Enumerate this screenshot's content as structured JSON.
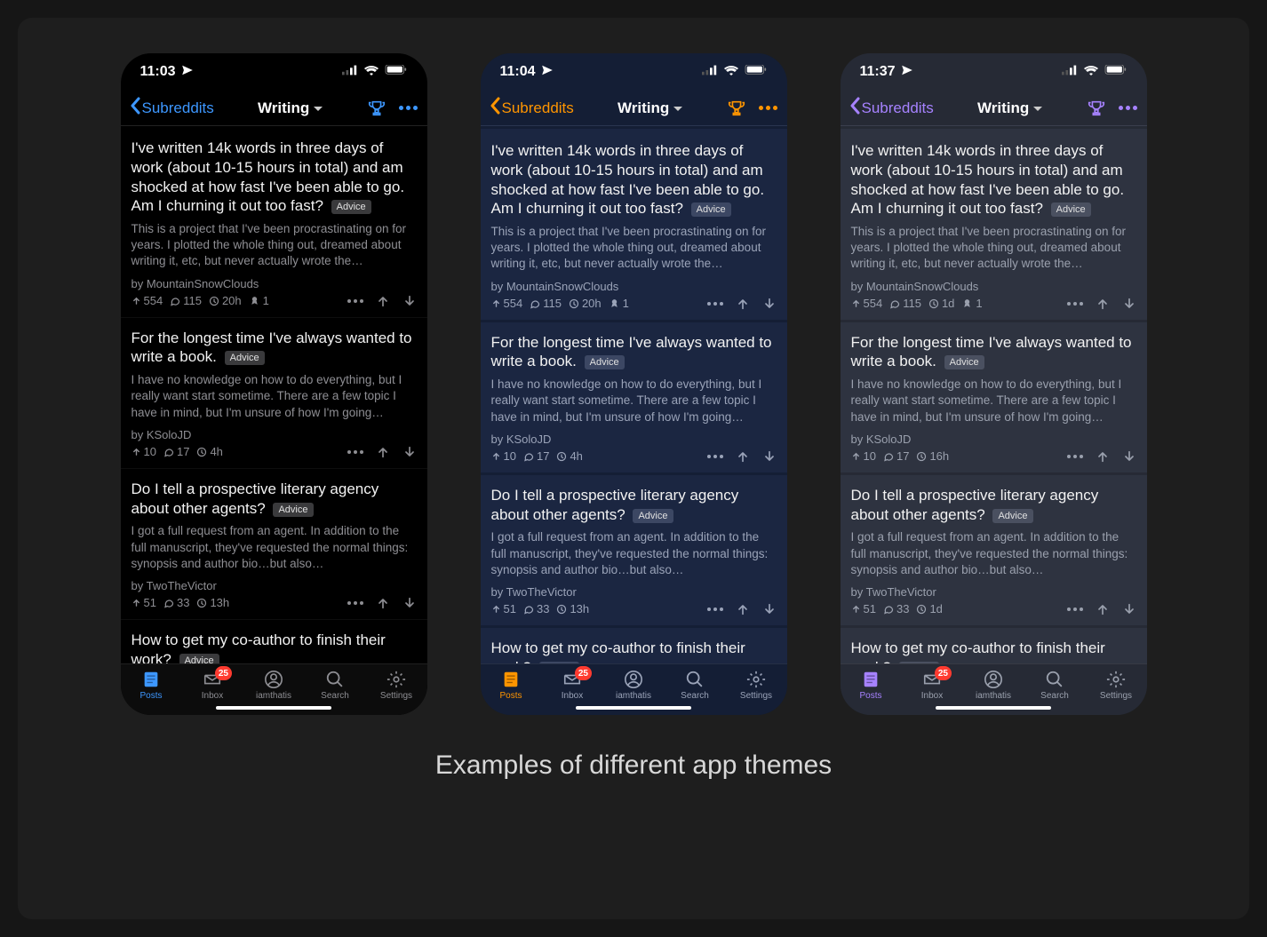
{
  "caption": "Examples of different app themes",
  "tabbar": {
    "items": [
      "Posts",
      "Inbox",
      "iamthatis",
      "Search",
      "Settings"
    ],
    "badge": 25,
    "active": 0
  },
  "navbar": {
    "back_label": "Subreddits",
    "title": "Writing"
  },
  "phones": [
    {
      "time": "11:03",
      "accent": "#3d97ff",
      "theme": "t0"
    },
    {
      "time": "11:04",
      "accent": "#ff9500",
      "theme": "t1"
    },
    {
      "time": "11:37",
      "accent": "#a682ff",
      "theme": "t2"
    }
  ],
  "posts_01": [
    {
      "title": "I've written 14k words in three days of work (about 10-15 hours in total) and am shocked at how fast I've been able to go. Am I churning it out too fast?",
      "flair": "Advice",
      "excerpt": "This is a project that I've been procrastinating on for years. I plotted the whole thing out, dreamed about writing it, etc, but never actually wrote the…",
      "author": "MountainSnowClouds",
      "score": 554,
      "comments": 115,
      "age": "20h",
      "awards": 1
    },
    {
      "title": "For the longest time I've always wanted to write a book.",
      "flair": "Advice",
      "excerpt": "I have no knowledge on how to do everything, but I really want start sometime. There are a few topic I have in mind, but I'm unsure of how I'm going…",
      "author": "KSoloJD",
      "score": 10,
      "comments": 17,
      "age": "4h"
    },
    {
      "title": "Do I tell a prospective literary agency about other agents?",
      "flair": "Advice",
      "excerpt": "I got a full request from an agent. In addition to the full manuscript, they've requested the normal things: synopsis and author bio…but also…",
      "author": "TwoTheVictor",
      "score": 51,
      "comments": 33,
      "age": "13h"
    },
    {
      "title": "How to get my co-author to finish their work?",
      "flair": "Advice"
    }
  ],
  "posts_2": [
    {
      "title": "I've written 14k words in three days of work (about 10-15 hours in total) and am shocked at how fast I've been able to go. Am I churning it out too fast?",
      "flair": "Advice",
      "excerpt": "This is a project that I've been procrastinating on for years. I plotted the whole thing out, dreamed about writing it, etc, but never actually wrote the…",
      "author": "MountainSnowClouds",
      "score": 554,
      "comments": 115,
      "age": "1d",
      "awards": 1
    },
    {
      "title": "For the longest time I've always wanted to write a book.",
      "flair": "Advice",
      "excerpt": "I have no knowledge on how to do everything, but I really want start sometime. There are a few topic I have in mind, but I'm unsure of how I'm going…",
      "author": "KSoloJD",
      "score": 10,
      "comments": 17,
      "age": "16h"
    },
    {
      "title": "Do I tell a prospective literary agency about other agents?",
      "flair": "Advice",
      "excerpt": "I got a full request from an agent. In addition to the full manuscript, they've requested the normal things: synopsis and author bio…but also…",
      "author": "TwoTheVictor",
      "score": 51,
      "comments": 33,
      "age": "1d"
    },
    {
      "title": "How to get my co-author to finish their work?",
      "flair": "Advice"
    }
  ]
}
